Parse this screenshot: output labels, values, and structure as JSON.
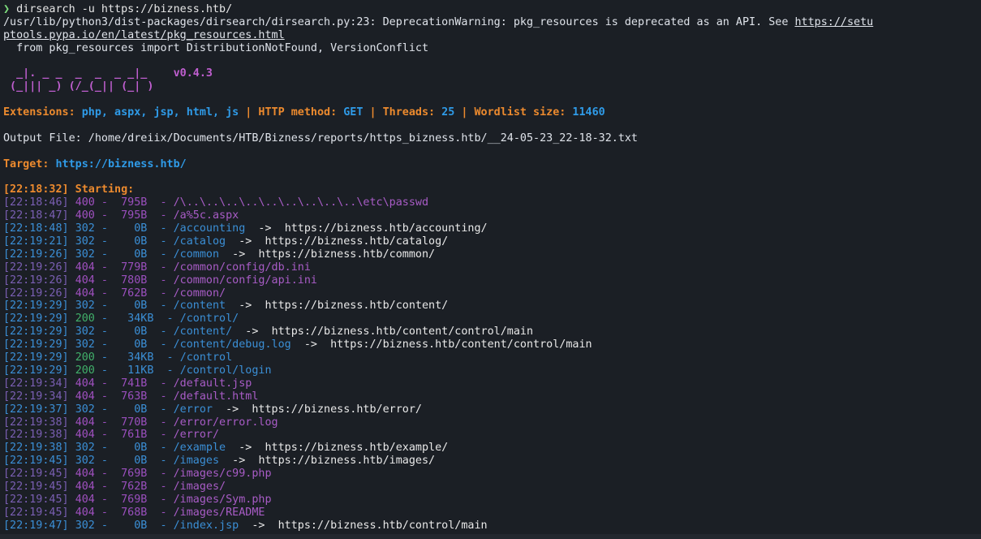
{
  "prompt": {
    "arrow": "❯",
    "command": "dirsearch -u https://bizness.htb/"
  },
  "warning": {
    "line1_prefix": "/usr/lib/python3/dist-packages/dirsearch/dirsearch.py:23: DeprecationWarning: pkg_resources is deprecated as an API. See ",
    "line1_link": "https://setu",
    "line2_link": "ptools.pypa.io/en/latest/pkg_resources.html",
    "line3": "  from pkg_resources import DistributionNotFound, VersionConflict"
  },
  "banner": {
    "line1": "  _|. _ _  _  _  _ _|_    v0.4.3",
    "line2": " (_||| _) (/_(_|| (_| )"
  },
  "config": {
    "extensions_label": "Extensions:",
    "extensions_value": "php, aspx, jsp, html, js",
    "method_label": "HTTP method:",
    "method_value": "GET",
    "threads_label": "Threads:",
    "threads_value": "25",
    "wordlist_label": "Wordlist size:",
    "wordlist_value": "11460",
    "separator": "|"
  },
  "output_file": "Output File: /home/dreiix/Documents/HTB/Bizness/reports/https_bizness.htb/__24-05-23_22-18-32.txt",
  "target": {
    "label": "Target:",
    "value": "https://bizness.htb/"
  },
  "starting": "[22:18:32] Starting:",
  "results": [
    {
      "ts": "[22:18:46]",
      "status": "400",
      "size": " 795B",
      "path": "/\\..\\..\\..\\..\\..\\..\\..\\..\\..\\etc\\passwd",
      "redirect": ""
    },
    {
      "ts": "[22:18:47]",
      "status": "400",
      "size": " 795B",
      "path": "/a%5c.aspx",
      "redirect": ""
    },
    {
      "ts": "[22:18:48]",
      "status": "302",
      "size": "   0B",
      "path": "/accounting",
      "redirect": "https://bizness.htb/accounting/"
    },
    {
      "ts": "[22:19:21]",
      "status": "302",
      "size": "   0B",
      "path": "/catalog",
      "redirect": "https://bizness.htb/catalog/"
    },
    {
      "ts": "[22:19:26]",
      "status": "302",
      "size": "   0B",
      "path": "/common",
      "redirect": "https://bizness.htb/common/"
    },
    {
      "ts": "[22:19:26]",
      "status": "404",
      "size": " 779B",
      "path": "/common/config/db.ini",
      "redirect": ""
    },
    {
      "ts": "[22:19:26]",
      "status": "404",
      "size": " 780B",
      "path": "/common/config/api.ini",
      "redirect": ""
    },
    {
      "ts": "[22:19:26]",
      "status": "404",
      "size": " 762B",
      "path": "/common/",
      "redirect": ""
    },
    {
      "ts": "[22:19:29]",
      "status": "302",
      "size": "   0B",
      "path": "/content",
      "redirect": "https://bizness.htb/content/"
    },
    {
      "ts": "[22:19:29]",
      "status": "200",
      "size": "  34KB",
      "path": "/control/",
      "redirect": ""
    },
    {
      "ts": "[22:19:29]",
      "status": "302",
      "size": "   0B",
      "path": "/content/",
      "redirect": "https://bizness.htb/content/control/main"
    },
    {
      "ts": "[22:19:29]",
      "status": "302",
      "size": "   0B",
      "path": "/content/debug.log",
      "redirect": "https://bizness.htb/content/control/main"
    },
    {
      "ts": "[22:19:29]",
      "status": "200",
      "size": "  34KB",
      "path": "/control",
      "redirect": ""
    },
    {
      "ts": "[22:19:29]",
      "status": "200",
      "size": "  11KB",
      "path": "/control/login",
      "redirect": ""
    },
    {
      "ts": "[22:19:34]",
      "status": "404",
      "size": " 741B",
      "path": "/default.jsp",
      "redirect": ""
    },
    {
      "ts": "[22:19:34]",
      "status": "404",
      "size": " 763B",
      "path": "/default.html",
      "redirect": ""
    },
    {
      "ts": "[22:19:37]",
      "status": "302",
      "size": "   0B",
      "path": "/error",
      "redirect": "https://bizness.htb/error/"
    },
    {
      "ts": "[22:19:38]",
      "status": "404",
      "size": " 770B",
      "path": "/error/error.log",
      "redirect": ""
    },
    {
      "ts": "[22:19:38]",
      "status": "404",
      "size": " 761B",
      "path": "/error/",
      "redirect": ""
    },
    {
      "ts": "[22:19:38]",
      "status": "302",
      "size": "   0B",
      "path": "/example",
      "redirect": "https://bizness.htb/example/"
    },
    {
      "ts": "[22:19:45]",
      "status": "302",
      "size": "   0B",
      "path": "/images",
      "redirect": "https://bizness.htb/images/"
    },
    {
      "ts": "[22:19:45]",
      "status": "404",
      "size": " 769B",
      "path": "/images/c99.php",
      "redirect": ""
    },
    {
      "ts": "[22:19:45]",
      "status": "404",
      "size": " 762B",
      "path": "/images/",
      "redirect": ""
    },
    {
      "ts": "[22:19:45]",
      "status": "404",
      "size": " 769B",
      "path": "/images/Sym.php",
      "redirect": ""
    },
    {
      "ts": "[22:19:45]",
      "status": "404",
      "size": " 768B",
      "path": "/images/README",
      "redirect": ""
    },
    {
      "ts": "[22:19:47]",
      "status": "302",
      "size": "   0B",
      "path": "/index.jsp",
      "redirect": "https://bizness.htb/control/main"
    }
  ]
}
